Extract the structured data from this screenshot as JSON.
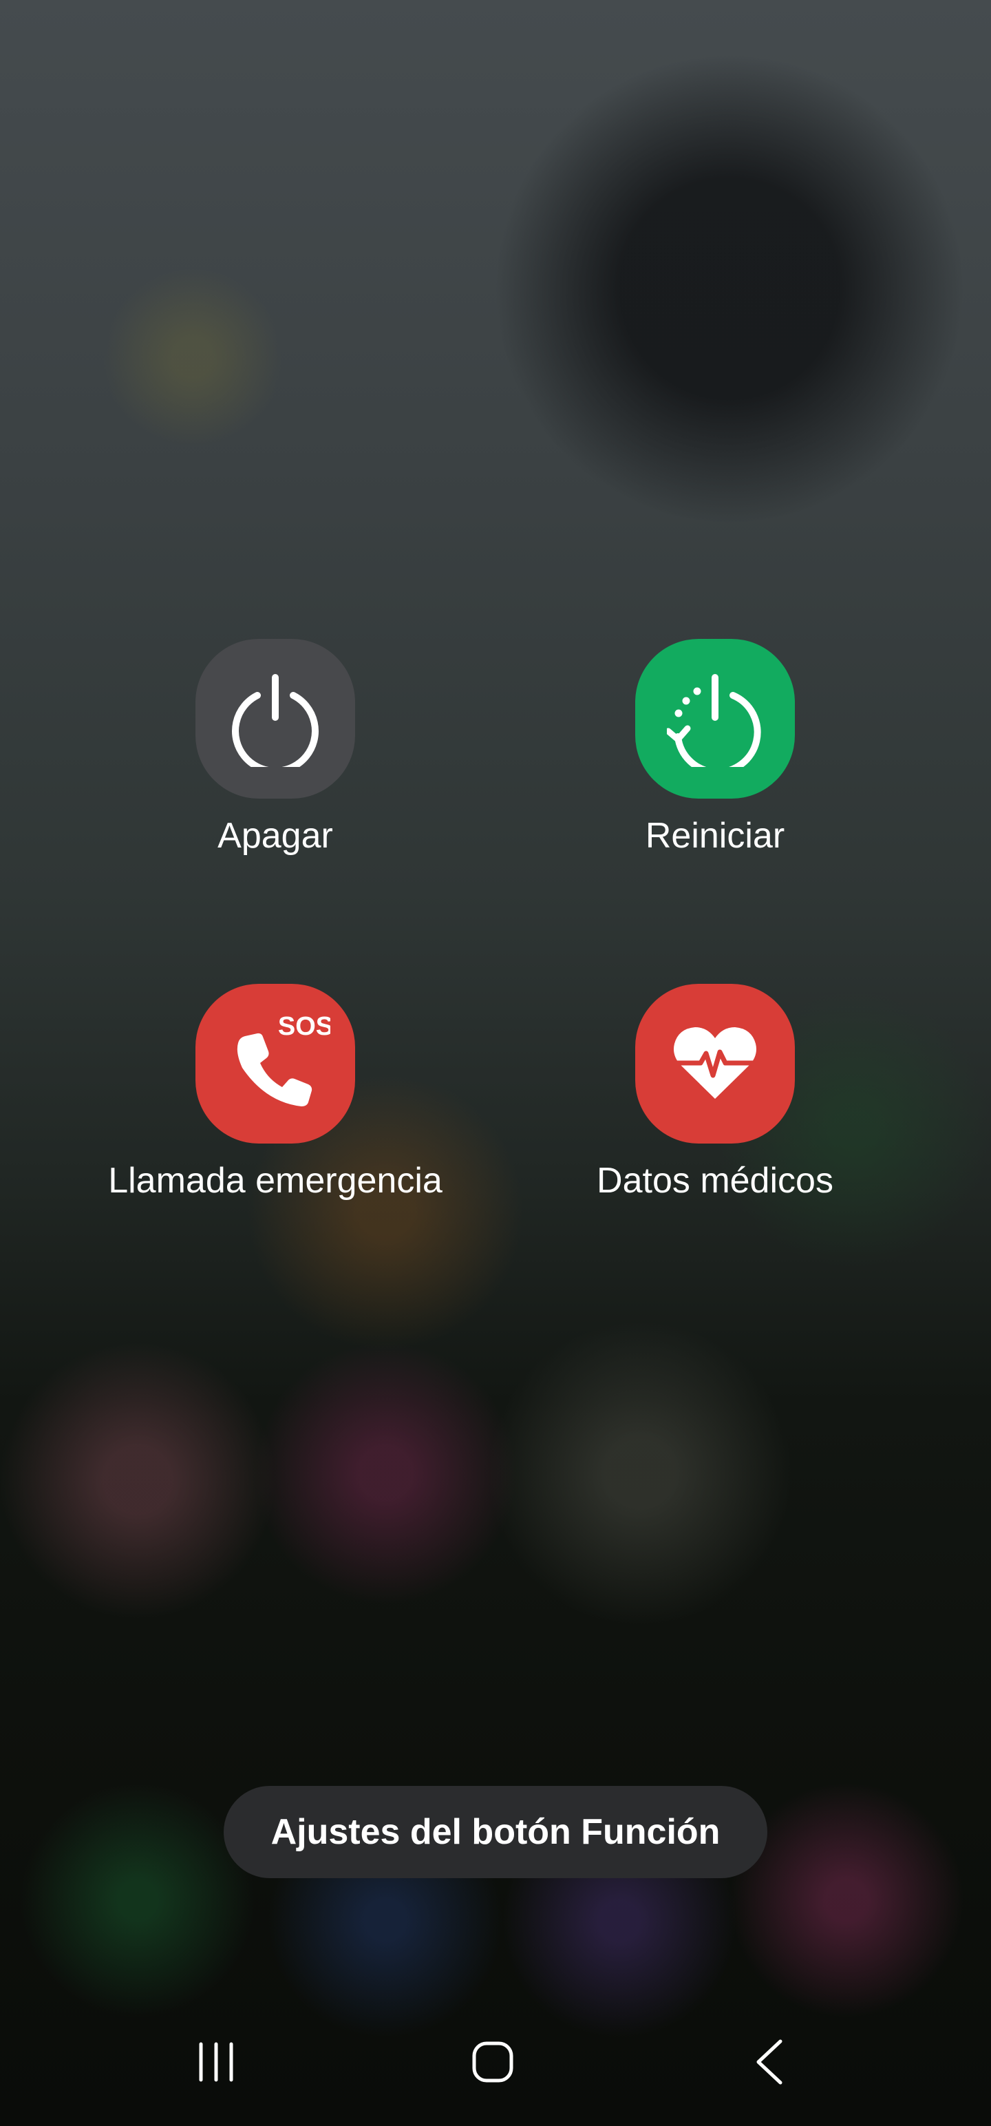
{
  "colors": {
    "power_off_tile": "#48494c",
    "restart_tile": "#12ab5f",
    "emergency_tile": "#d83d37",
    "medical_tile": "#d83d37",
    "pill_background": "#2b2c2e",
    "label_text": "#ffffff"
  },
  "power_menu": {
    "power_off": {
      "label": "Apagar",
      "icon": "power-icon"
    },
    "restart": {
      "label": "Reiniciar",
      "icon": "restart-icon"
    },
    "emergency_call": {
      "label": "Llamada emergencia",
      "icon": "sos-phone-icon",
      "badge": "SOS"
    },
    "medical_info": {
      "label": "Datos médicos",
      "icon": "heart-pulse-icon"
    }
  },
  "function_button": {
    "label": "Ajustes del botón Función"
  },
  "nav_bar": {
    "recents_icon": "recents-icon",
    "home_icon": "home-icon",
    "back_icon": "back-icon"
  }
}
